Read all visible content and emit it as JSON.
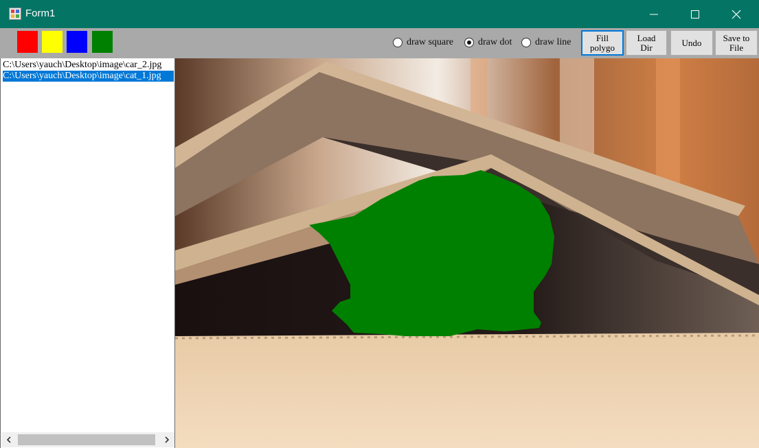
{
  "window": {
    "title": "Form1",
    "controls": [
      "minimize-icon",
      "maximize-icon",
      "close-icon"
    ]
  },
  "toolbar": {
    "swatches": [
      {
        "name": "red",
        "color": "#ff0000"
      },
      {
        "name": "yellow",
        "color": "#ffff00"
      },
      {
        "name": "blue",
        "color": "#0000ff"
      },
      {
        "name": "green",
        "color": "#008000"
      }
    ],
    "modes": [
      {
        "label": "draw square",
        "checked": false
      },
      {
        "label": "draw dot",
        "checked": true
      },
      {
        "label": "draw line",
        "checked": false
      }
    ],
    "buttons": {
      "fill": "Fill\npolygo",
      "load": "Load\nDir",
      "undo": "Undo",
      "save": "Save to\nFile"
    }
  },
  "files": {
    "items": [
      {
        "path": "C:\\Users\\yauch\\Desktop\\image\\car_2.jpg",
        "selected": false
      },
      {
        "path": "C:\\Users\\yauch\\Desktop\\image\\cat_1.jpg",
        "selected": true
      }
    ]
  },
  "canvas": {
    "image": "cat_1.jpg",
    "overlay_color": "#008000"
  },
  "colors": {
    "titlebar": "#047565",
    "toolbar": "#a9a9a9",
    "selection": "#0078d7",
    "focus_border": "#0078d7"
  }
}
